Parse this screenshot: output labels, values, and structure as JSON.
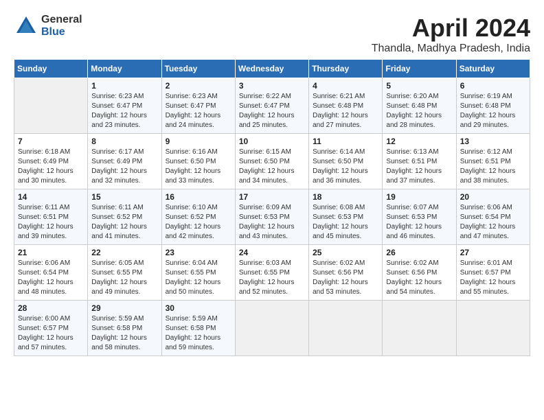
{
  "header": {
    "logo_general": "General",
    "logo_blue": "Blue",
    "month_title": "April 2024",
    "location": "Thandla, Madhya Pradesh, India"
  },
  "calendar": {
    "weekdays": [
      "Sunday",
      "Monday",
      "Tuesday",
      "Wednesday",
      "Thursday",
      "Friday",
      "Saturday"
    ],
    "weeks": [
      [
        {
          "day": "",
          "info": ""
        },
        {
          "day": "1",
          "info": "Sunrise: 6:23 AM\nSunset: 6:47 PM\nDaylight: 12 hours\nand 23 minutes."
        },
        {
          "day": "2",
          "info": "Sunrise: 6:23 AM\nSunset: 6:47 PM\nDaylight: 12 hours\nand 24 minutes."
        },
        {
          "day": "3",
          "info": "Sunrise: 6:22 AM\nSunset: 6:47 PM\nDaylight: 12 hours\nand 25 minutes."
        },
        {
          "day": "4",
          "info": "Sunrise: 6:21 AM\nSunset: 6:48 PM\nDaylight: 12 hours\nand 27 minutes."
        },
        {
          "day": "5",
          "info": "Sunrise: 6:20 AM\nSunset: 6:48 PM\nDaylight: 12 hours\nand 28 minutes."
        },
        {
          "day": "6",
          "info": "Sunrise: 6:19 AM\nSunset: 6:48 PM\nDaylight: 12 hours\nand 29 minutes."
        }
      ],
      [
        {
          "day": "7",
          "info": "Sunrise: 6:18 AM\nSunset: 6:49 PM\nDaylight: 12 hours\nand 30 minutes."
        },
        {
          "day": "8",
          "info": "Sunrise: 6:17 AM\nSunset: 6:49 PM\nDaylight: 12 hours\nand 32 minutes."
        },
        {
          "day": "9",
          "info": "Sunrise: 6:16 AM\nSunset: 6:50 PM\nDaylight: 12 hours\nand 33 minutes."
        },
        {
          "day": "10",
          "info": "Sunrise: 6:15 AM\nSunset: 6:50 PM\nDaylight: 12 hours\nand 34 minutes."
        },
        {
          "day": "11",
          "info": "Sunrise: 6:14 AM\nSunset: 6:50 PM\nDaylight: 12 hours\nand 36 minutes."
        },
        {
          "day": "12",
          "info": "Sunrise: 6:13 AM\nSunset: 6:51 PM\nDaylight: 12 hours\nand 37 minutes."
        },
        {
          "day": "13",
          "info": "Sunrise: 6:12 AM\nSunset: 6:51 PM\nDaylight: 12 hours\nand 38 minutes."
        }
      ],
      [
        {
          "day": "14",
          "info": "Sunrise: 6:11 AM\nSunset: 6:51 PM\nDaylight: 12 hours\nand 39 minutes."
        },
        {
          "day": "15",
          "info": "Sunrise: 6:11 AM\nSunset: 6:52 PM\nDaylight: 12 hours\nand 41 minutes."
        },
        {
          "day": "16",
          "info": "Sunrise: 6:10 AM\nSunset: 6:52 PM\nDaylight: 12 hours\nand 42 minutes."
        },
        {
          "day": "17",
          "info": "Sunrise: 6:09 AM\nSunset: 6:53 PM\nDaylight: 12 hours\nand 43 minutes."
        },
        {
          "day": "18",
          "info": "Sunrise: 6:08 AM\nSunset: 6:53 PM\nDaylight: 12 hours\nand 45 minutes."
        },
        {
          "day": "19",
          "info": "Sunrise: 6:07 AM\nSunset: 6:53 PM\nDaylight: 12 hours\nand 46 minutes."
        },
        {
          "day": "20",
          "info": "Sunrise: 6:06 AM\nSunset: 6:54 PM\nDaylight: 12 hours\nand 47 minutes."
        }
      ],
      [
        {
          "day": "21",
          "info": "Sunrise: 6:06 AM\nSunset: 6:54 PM\nDaylight: 12 hours\nand 48 minutes."
        },
        {
          "day": "22",
          "info": "Sunrise: 6:05 AM\nSunset: 6:55 PM\nDaylight: 12 hours\nand 49 minutes."
        },
        {
          "day": "23",
          "info": "Sunrise: 6:04 AM\nSunset: 6:55 PM\nDaylight: 12 hours\nand 50 minutes."
        },
        {
          "day": "24",
          "info": "Sunrise: 6:03 AM\nSunset: 6:55 PM\nDaylight: 12 hours\nand 52 minutes."
        },
        {
          "day": "25",
          "info": "Sunrise: 6:02 AM\nSunset: 6:56 PM\nDaylight: 12 hours\nand 53 minutes."
        },
        {
          "day": "26",
          "info": "Sunrise: 6:02 AM\nSunset: 6:56 PM\nDaylight: 12 hours\nand 54 minutes."
        },
        {
          "day": "27",
          "info": "Sunrise: 6:01 AM\nSunset: 6:57 PM\nDaylight: 12 hours\nand 55 minutes."
        }
      ],
      [
        {
          "day": "28",
          "info": "Sunrise: 6:00 AM\nSunset: 6:57 PM\nDaylight: 12 hours\nand 57 minutes."
        },
        {
          "day": "29",
          "info": "Sunrise: 5:59 AM\nSunset: 6:58 PM\nDaylight: 12 hours\nand 58 minutes."
        },
        {
          "day": "30",
          "info": "Sunrise: 5:59 AM\nSunset: 6:58 PM\nDaylight: 12 hours\nand 59 minutes."
        },
        {
          "day": "",
          "info": ""
        },
        {
          "day": "",
          "info": ""
        },
        {
          "day": "",
          "info": ""
        },
        {
          "day": "",
          "info": ""
        }
      ]
    ]
  }
}
